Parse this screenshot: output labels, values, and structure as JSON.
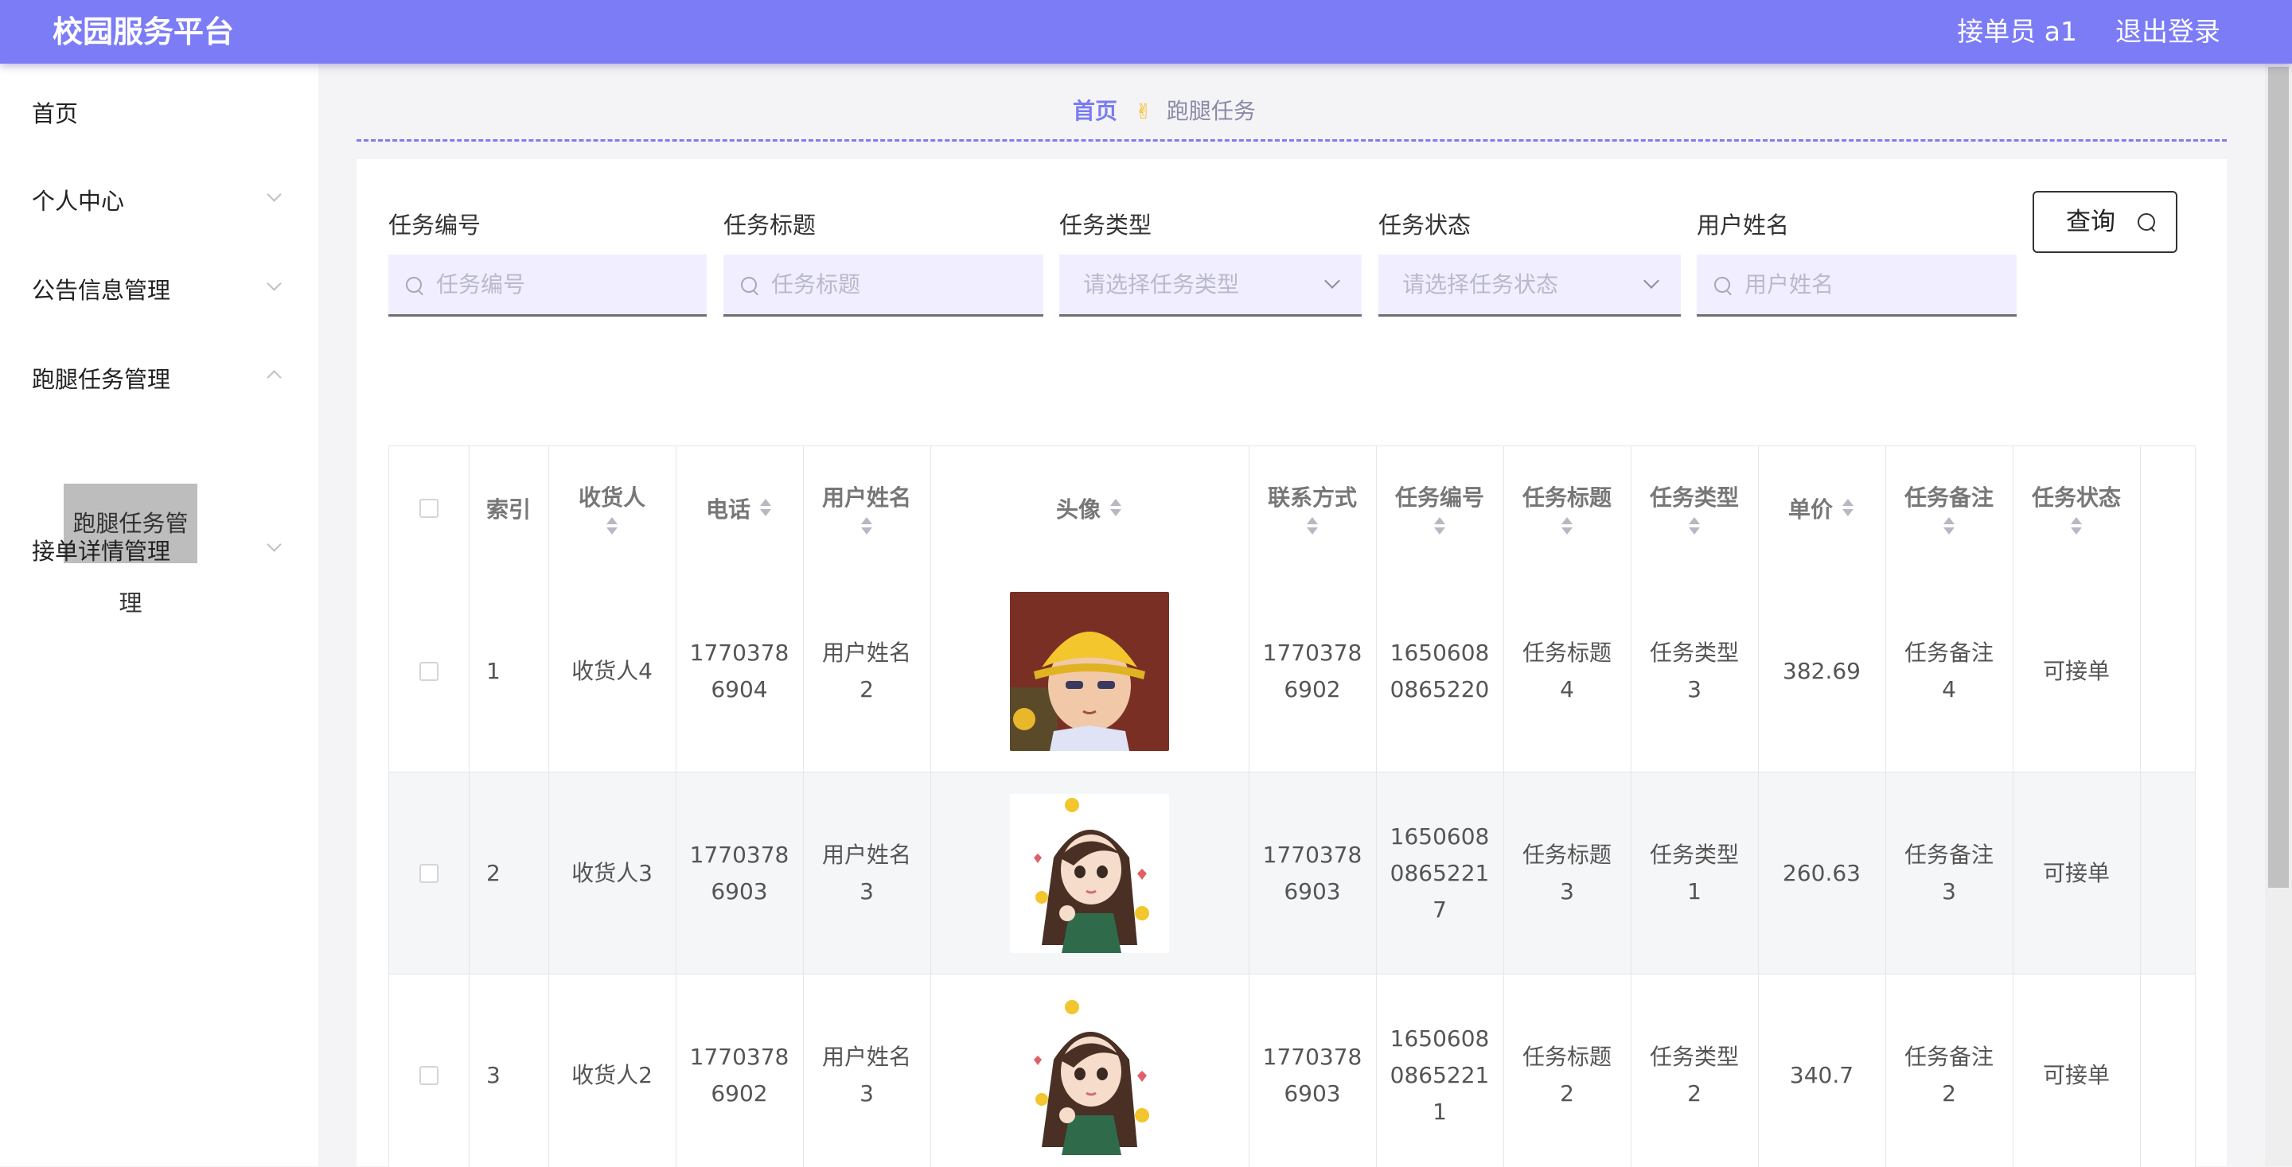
{
  "app": {
    "title": "校园服务平台"
  },
  "header": {
    "user": "接单员 a1",
    "logout": "退出登录"
  },
  "sidebar": {
    "items": [
      {
        "label": "首页"
      },
      {
        "label": "个人中心"
      },
      {
        "label": "公告信息管理"
      },
      {
        "label": "跑腿任务管理"
      },
      {
        "label": "接单详情管理"
      }
    ],
    "active_sub": "跑腿任务管理"
  },
  "breadcrumb": {
    "home": "首页",
    "separator": "✌",
    "current": "跑腿任务"
  },
  "filters": {
    "task_no": {
      "label": "任务编号",
      "placeholder": "任务编号"
    },
    "task_title": {
      "label": "任务标题",
      "placeholder": "任务标题"
    },
    "task_type": {
      "label": "任务类型",
      "placeholder": "请选择任务类型"
    },
    "task_status": {
      "label": "任务状态",
      "placeholder": "请选择任务状态"
    },
    "user_name": {
      "label": "用户姓名",
      "placeholder": "用户姓名"
    },
    "query_button": "查询"
  },
  "table": {
    "columns": [
      "索引",
      "收货人",
      "电话",
      "用户姓名",
      "头像",
      "联系方式",
      "任务编号",
      "任务标题",
      "任务类型",
      "单价",
      "任务备注",
      "任务状态"
    ],
    "rows": [
      {
        "index": "1",
        "receiver": "收货人4",
        "phone": [
          "1770378",
          "6904"
        ],
        "user": [
          "用户姓名",
          "2"
        ],
        "avatar": "boy-yellow-hat",
        "contact": [
          "1770378",
          "6902"
        ],
        "task_no": [
          "1650608",
          "0865220"
        ],
        "title": [
          "任务标题",
          "4"
        ],
        "type": [
          "任务类型",
          "3"
        ],
        "price": "382.69",
        "note": [
          "任务备注",
          "4"
        ],
        "status": "可接单"
      },
      {
        "index": "2",
        "receiver": "收货人3",
        "phone": [
          "1770378",
          "6903"
        ],
        "user": [
          "用户姓名",
          "3"
        ],
        "avatar": "girl-long-hair",
        "contact": [
          "1770378",
          "6903"
        ],
        "task_no": [
          "1650608",
          "0865221",
          "7"
        ],
        "title": [
          "任务标题",
          "3"
        ],
        "type": [
          "任务类型",
          "1"
        ],
        "price": "260.63",
        "note": [
          "任务备注",
          "3"
        ],
        "status": "可接单"
      },
      {
        "index": "3",
        "receiver": "收货人2",
        "phone": [
          "1770378",
          "6902"
        ],
        "user": [
          "用户姓名",
          "3"
        ],
        "avatar": "girl-long-hair",
        "contact": [
          "1770378",
          "6903"
        ],
        "task_no": [
          "1650608",
          "0865221",
          "1"
        ],
        "title": [
          "任务标题",
          "2"
        ],
        "type": [
          "任务类型",
          "2"
        ],
        "price": "340.7",
        "note": [
          "任务备注",
          "2"
        ],
        "status": "可接单"
      }
    ]
  }
}
